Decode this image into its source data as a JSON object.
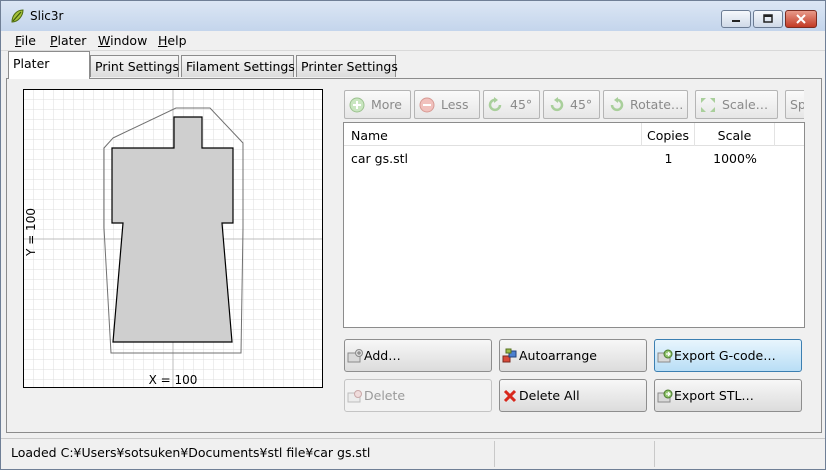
{
  "window": {
    "title": "Slic3r"
  },
  "menu": [
    {
      "label": "File",
      "underline": "F",
      "rest": "ile"
    },
    {
      "label": "Plater",
      "underline": "P",
      "rest": "later"
    },
    {
      "label": "Window",
      "underline": "W",
      "rest": "indow"
    },
    {
      "label": "Help",
      "underline": "H",
      "rest": "elp"
    }
  ],
  "tabs": [
    "Plater",
    "Print Settings",
    "Filament Settings",
    "Printer Settings"
  ],
  "canvas": {
    "x_label": "X = 100",
    "y_label": "Y = 100"
  },
  "toolbar": {
    "more": "More",
    "less": "Less",
    "rotate_left": "45°",
    "rotate_right": "45°",
    "rotate": "Rotate…",
    "scale": "Scale…",
    "split": "Sp"
  },
  "object_list": {
    "columns": [
      "Name",
      "Copies",
      "Scale"
    ],
    "rows": [
      {
        "name": "car gs.stl",
        "copies": "1",
        "scale": "1000%"
      }
    ]
  },
  "buttons": {
    "add": "Add…",
    "autoarrange": "Autoarrange",
    "export_gcode": "Export G-code…",
    "delete": "Delete",
    "delete_all": "Delete All",
    "export_stl": "Export STL…"
  },
  "status": {
    "text": "Loaded C:¥Users¥sotsuken¥Documents¥stl file¥car gs.stl"
  }
}
